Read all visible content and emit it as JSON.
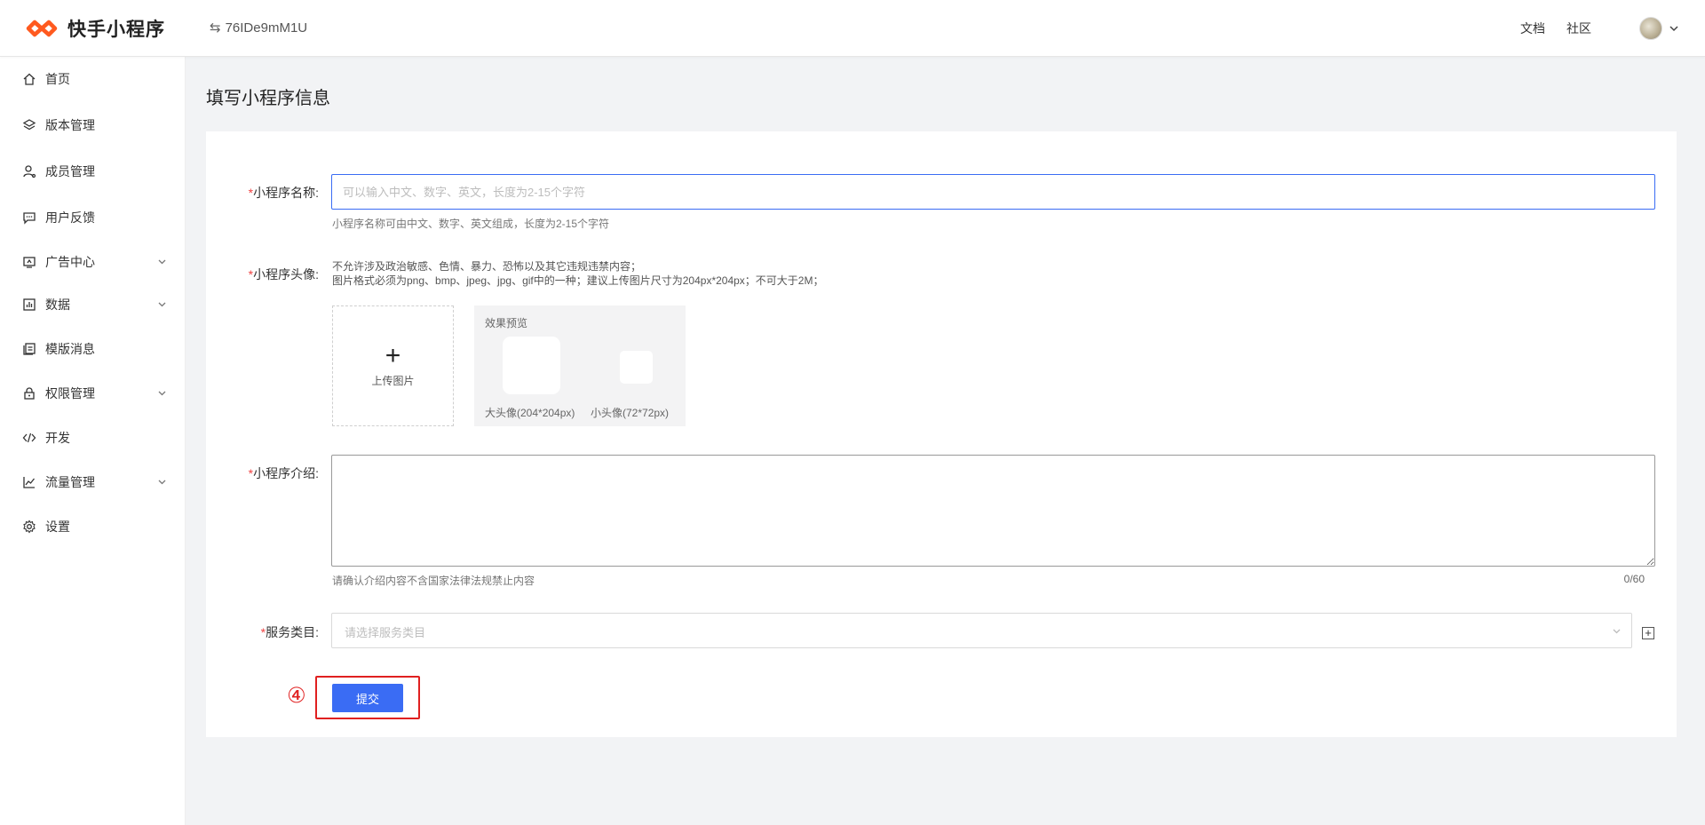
{
  "header": {
    "brand": "快手小程序",
    "app_id": "76IDe9mM1U",
    "links": [
      "文档",
      "社区"
    ],
    "brand_color": "#ff5a1f",
    "icons": {
      "swap": "swap-icon",
      "chevron": "chevron-down-icon"
    }
  },
  "sidebar": {
    "items": [
      {
        "label": "首页",
        "icon": "home-icon",
        "has_children": false
      },
      {
        "label": "版本管理",
        "icon": "layers-icon",
        "has_children": false
      },
      {
        "label": "成员管理",
        "icon": "user-icon",
        "has_children": false
      },
      {
        "label": "用户反馈",
        "icon": "chat-icon",
        "has_children": false
      },
      {
        "label": "广告中心",
        "icon": "ad-icon",
        "has_children": true
      },
      {
        "label": "数据",
        "icon": "chart-icon",
        "has_children": true
      },
      {
        "label": "模版消息",
        "icon": "template-icon",
        "has_children": false
      },
      {
        "label": "权限管理",
        "icon": "lock-icon",
        "has_children": true
      },
      {
        "label": "开发",
        "icon": "code-icon",
        "has_children": false
      },
      {
        "label": "流量管理",
        "icon": "trend-icon",
        "has_children": true
      },
      {
        "label": "设置",
        "icon": "gear-icon",
        "has_children": false
      }
    ]
  },
  "page": {
    "title": "填写小程序信息"
  },
  "form": {
    "required_mark": "*",
    "name": {
      "label": "小程序名称:",
      "placeholder": "可以输入中文、数字、英文，长度为2-15个字符",
      "value": "",
      "hint": "小程序名称可由中文、数字、英文组成，长度为2-15个字符"
    },
    "avatar": {
      "label": "小程序头像:",
      "rule_1": "不允许涉及政治敏感、色情、暴力、恐怖以及其它违规违禁内容；",
      "rule_2": "图片格式必须为png、bmp、jpeg、jpg、gif中的一种；建议上传图片尺寸为204px*204px；不可大于2M；",
      "upload_label": "上传图片",
      "preview_title": "效果预览",
      "preview_big_caption": "大头像(204*204px)",
      "preview_small_caption": "小头像(72*72px)"
    },
    "intro": {
      "label": "小程序介绍:",
      "value": "",
      "hint": "请确认介绍内容不含国家法律法规禁止内容",
      "counter": "0/60"
    },
    "category": {
      "label": "服务类目:",
      "placeholder": "请选择服务类目",
      "add_symbol": "+"
    },
    "submit_label": "提交",
    "annotation_marker": "④",
    "accent_color": "#3a6cf4",
    "highlight_color": "#e02020"
  }
}
